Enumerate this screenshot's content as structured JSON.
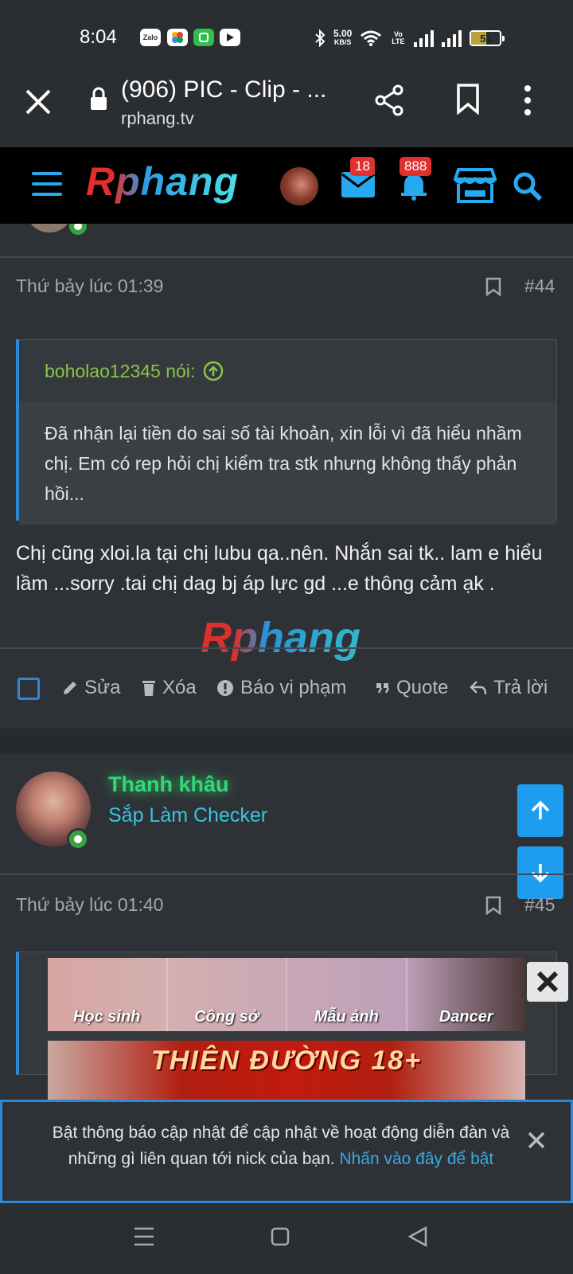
{
  "status_bar": {
    "time": "8:04",
    "apps": [
      "Zalo",
      "photos",
      "wechat",
      "youtube"
    ],
    "net_speed": "5.00",
    "net_unit": "KB/S",
    "volte": "Vo LTE",
    "battery": "51"
  },
  "browser": {
    "title": "(906) PIC - Clip - ...",
    "url": "rphang.tv"
  },
  "site_header": {
    "logo": "Rphang",
    "mail_count": "18",
    "alert_count": "888"
  },
  "post44": {
    "date": "Thứ bảy lúc 01:39",
    "number": "#44",
    "quote_author": "boholao12345 nói:",
    "quote_text": "Đã nhận lại tiền do sai số tài khoản, xin lỗi vì đã hiểu nhầm chị. Em có rep hỏi chị kiểm tra stk nhưng không thấy phản hồi...",
    "message": "Chị cũng xloi.la tại chị lubu qa..nên. Nhắn sai tk.. lam e hiểu lầm ...sorry .tai chị dag bj áp lực gd ...e thông cảm ạk .",
    "actions": {
      "edit": "Sửa",
      "delete": "Xóa",
      "report": "Báo vi phạm",
      "quote": "Quote",
      "reply": "Trả lời"
    }
  },
  "watermark": "Rphang",
  "post45": {
    "username": "Thanh khâu",
    "user_title": "Sắp Làm Checker",
    "date": "Thứ bảy lúc 01:40",
    "number": "#45",
    "partial_text": "..."
  },
  "ads": {
    "categories": [
      "Học sinh",
      "Công sở",
      "Mẫu ảnh",
      "Dancer"
    ],
    "banner": "THIÊN ĐƯỜNG 18+"
  },
  "notice": {
    "text": "Bật thông báo cập nhật để cập nhật về hoạt động diễn đàn và những gì liên quan tới nick của bạn.",
    "link": "Nhấn vào đây để bật"
  }
}
